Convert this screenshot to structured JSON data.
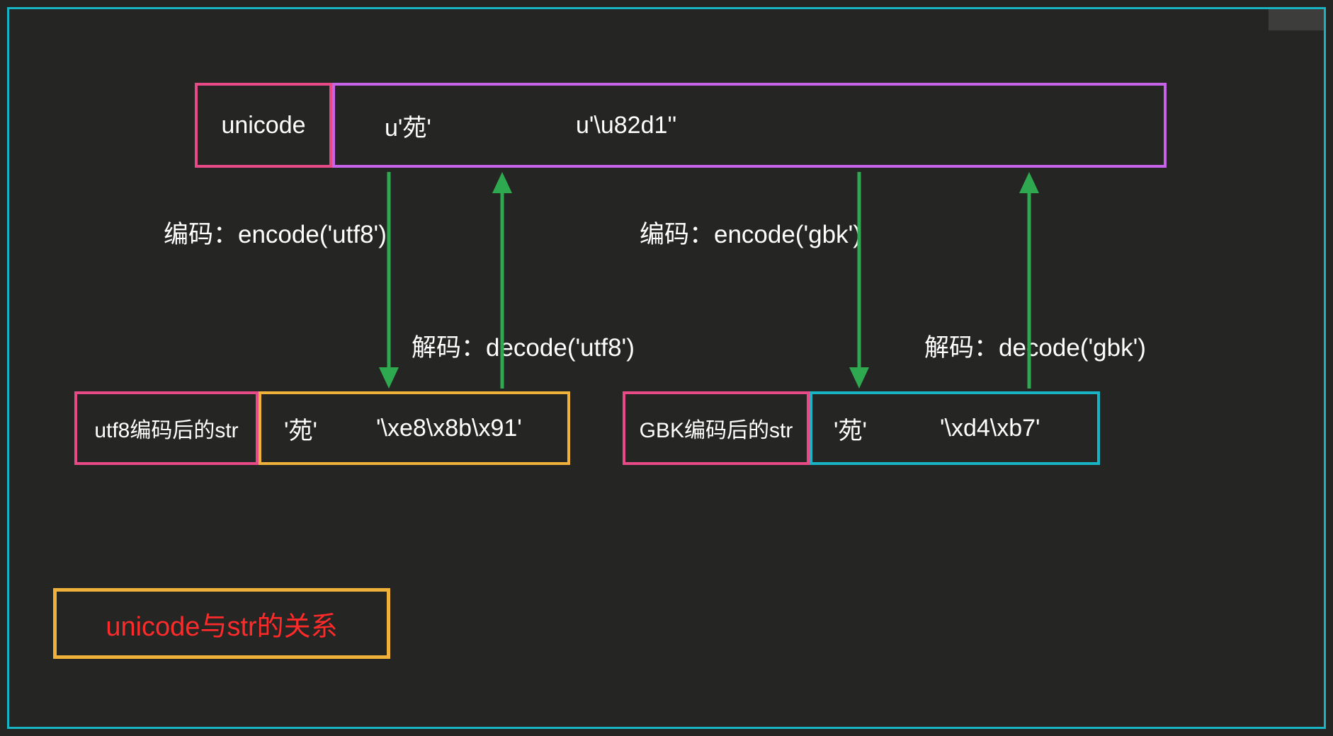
{
  "unicode": {
    "label": "unicode",
    "value1": "u'苑'",
    "value2": "u'\\u82d1''"
  },
  "labels": {
    "encode_utf8": "编码：encode('utf8')",
    "encode_gbk": "编码：encode('gbk')",
    "decode_utf8": "解码：decode('utf8')",
    "decode_gbk": "解码：decode('gbk')"
  },
  "utf8": {
    "label": "utf8编码后的str",
    "value1": "'苑'",
    "value2": "'\\xe8\\x8b\\x91'"
  },
  "gbk": {
    "label": "GBK编码后的str",
    "value1": "'苑'",
    "value2": "'\\xd4\\xb7'"
  },
  "title": "unicode与str的关系",
  "colors": {
    "pink": "#e84a87",
    "purple": "#c663e8",
    "orange": "#f0b13a",
    "cyan": "#19b4c4",
    "green": "#2fa94f",
    "red": "#ff2a2a",
    "bg": "#252524"
  }
}
